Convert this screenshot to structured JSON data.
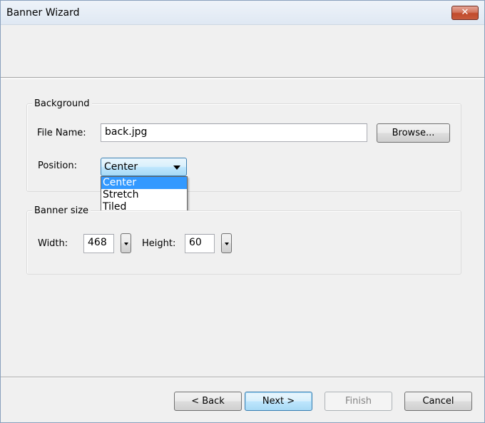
{
  "window": {
    "title": "Banner Wizard",
    "close_glyph": "✕"
  },
  "background_group": {
    "label": "Background",
    "file_name_label": "File Name:",
    "file_name_value": "back.jpg",
    "browse_label": "Browse...",
    "position_label": "Position:",
    "position_selected": "Center",
    "position_options": [
      "Center",
      "Stretch",
      "Tiled"
    ]
  },
  "banner_size_group": {
    "label": "Banner size",
    "width_label": "Width:",
    "width_value": "468",
    "height_label": "Height:",
    "height_value": "60"
  },
  "footer": {
    "back_label": "< Back",
    "next_label": "Next >",
    "finish_label": "Finish",
    "cancel_label": "Cancel"
  },
  "icons": {
    "close": "close-icon",
    "combo_arrow": "chevron-down-icon",
    "spin_arrow": "chevron-down-icon"
  },
  "colors": {
    "highlight": "#3399ff",
    "close_button": "#c75a3c",
    "default_button_border": "#3c7fb1"
  }
}
